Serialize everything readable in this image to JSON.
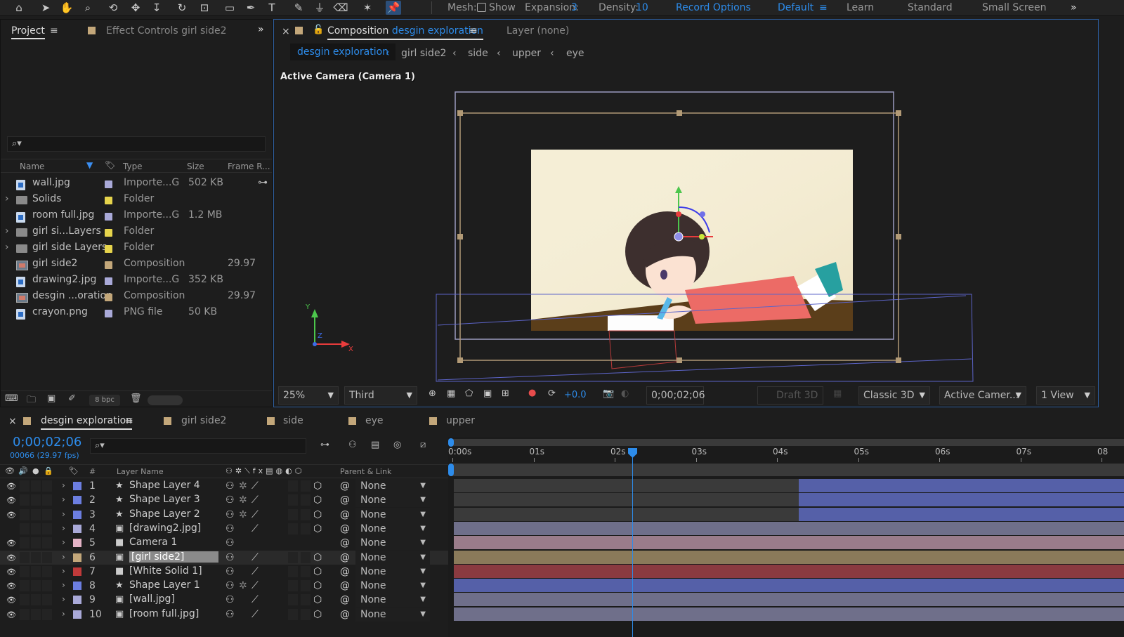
{
  "toolbar": {
    "mesh_label": "Mesh:",
    "show_label": "Show",
    "expansion_label": "Expansion:",
    "expansion_value": "3",
    "density_label": "Density:",
    "density_value": "10",
    "record_options": "Record Options",
    "workspaces": [
      "Default",
      "Learn",
      "Standard",
      "Small Screen"
    ],
    "overflow": "»"
  },
  "project_panel": {
    "tab_project": "Project",
    "tab_effect_controls": "Effect Controls girl side2",
    "overflow": "»",
    "columns": [
      "Name",
      "Type",
      "Size",
      "Frame R..."
    ],
    "items": [
      {
        "name": "wall.jpg",
        "type": "Importe...G",
        "size": "502 KB",
        "frame_rate": "",
        "kind": "file",
        "label_color": "#a9a9d8"
      },
      {
        "name": "Solids",
        "type": "Folder",
        "size": "",
        "frame_rate": "",
        "kind": "folder",
        "label_color": "#e6d44c"
      },
      {
        "name": "room full.jpg",
        "type": "Importe...G",
        "size": "1.2 MB",
        "frame_rate": "",
        "kind": "file",
        "label_color": "#a9a9d8"
      },
      {
        "name": "girl si...Layers",
        "type": "Folder",
        "size": "",
        "frame_rate": "",
        "kind": "folder",
        "label_color": "#e6d44c"
      },
      {
        "name": "girl side Layers",
        "type": "Folder",
        "size": "",
        "frame_rate": "",
        "kind": "folder",
        "label_color": "#e6d44c"
      },
      {
        "name": "girl side2",
        "type": "Composition",
        "size": "",
        "frame_rate": "29.97",
        "kind": "comp",
        "label_color": "#c3a77a"
      },
      {
        "name": "drawing2.jpg",
        "type": "Importe...G",
        "size": "352 KB",
        "frame_rate": "",
        "kind": "file",
        "label_color": "#a9a9d8"
      },
      {
        "name": "desgin ...oration",
        "type": "Composition",
        "size": "",
        "frame_rate": "29.97",
        "kind": "comp",
        "label_color": "#c3a77a"
      },
      {
        "name": "crayon.png",
        "type": "PNG file",
        "size": "50 KB",
        "frame_rate": "",
        "kind": "file",
        "label_color": "#a9a9d8"
      }
    ],
    "bpc": "8 bpc"
  },
  "composition_panel": {
    "close": "×",
    "tab_prefix": "Composition",
    "comp_name": "desgin exploration",
    "layer_tab": "Layer  (none)",
    "breadcrumbs": [
      "desgin exploration",
      "girl side2",
      "side",
      "upper",
      "eye"
    ],
    "camera_label": "Active Camera (Camera 1)",
    "axis_labels": {
      "x": "X",
      "y": "Y",
      "z": "Z"
    },
    "zoom": "25%",
    "resolution": "Third",
    "exposure": "+0.0",
    "timecode": "0;00;02;06",
    "draft3d": "Draft 3D",
    "renderer": "Classic 3D",
    "camera_view": "Active Camer...",
    "views": "1 View"
  },
  "timeline": {
    "tabs": [
      "desgin exploration",
      "girl side2",
      "side",
      "eye",
      "upper"
    ],
    "timecode": "0;00;02;06",
    "frame_info": "00066 (29.97 fps)",
    "col_number": "#",
    "col_layer_name": "Layer Name",
    "col_parent": "Parent & Link",
    "ruler": [
      "0:00s",
      "01s",
      "02s",
      "03s",
      "04s",
      "05s",
      "06s",
      "07s",
      "08"
    ],
    "layers": [
      {
        "num": "1",
        "name": "Shape Layer 4",
        "icon": "star-icon",
        "color": "#6c7ee0",
        "parent": "None",
        "bar_color": "#5560a8",
        "bar_start_pct": 51.5,
        "visible": true
      },
      {
        "num": "2",
        "name": "Shape Layer 3",
        "icon": "star-icon",
        "color": "#6c7ee0",
        "parent": "None",
        "bar_color": "#5560a8",
        "bar_start_pct": 51.5,
        "visible": true
      },
      {
        "num": "3",
        "name": "Shape Layer 2",
        "icon": "star-icon",
        "color": "#6c7ee0",
        "parent": "None",
        "bar_color": "#5560a8",
        "bar_start_pct": 51.5,
        "visible": true
      },
      {
        "num": "4",
        "name": "[drawing2.jpg]",
        "icon": "image-icon",
        "color": "#a9a9d8",
        "parent": "None",
        "bar_color": "#6f6f8a",
        "bar_start_pct": 0,
        "visible": false
      },
      {
        "num": "5",
        "name": "Camera 1",
        "icon": "camera-icon",
        "color": "#e4b3c6",
        "parent": "None",
        "bar_color": "#9a7c8a",
        "bar_start_pct": 0,
        "visible": true
      },
      {
        "num": "6",
        "name": "[girl side2]",
        "icon": "comp-icon",
        "color": "#c3a77a",
        "parent": "None",
        "bar_color": "#8a7a5a",
        "bar_start_pct": 0,
        "visible": true,
        "selected": true
      },
      {
        "num": "7",
        "name": "[White Solid 1]",
        "icon": "solid-icon",
        "color": "#c03a3a",
        "parent": "None",
        "bar_color": "#8a3a40",
        "bar_start_pct": 0,
        "visible": true
      },
      {
        "num": "8",
        "name": "Shape Layer 1",
        "icon": "star-icon",
        "color": "#6c7ee0",
        "parent": "None",
        "bar_color": "#5560a8",
        "bar_start_pct": 0,
        "visible": true
      },
      {
        "num": "9",
        "name": "[wall.jpg]",
        "icon": "image-icon",
        "color": "#a9a9d8",
        "parent": "None",
        "bar_color": "#6f6f8a",
        "bar_start_pct": 0,
        "visible": true
      },
      {
        "num": "10",
        "name": "[room full.jpg]",
        "icon": "image-icon",
        "color": "#a9a9d8",
        "parent": "None",
        "bar_color": "#6f6f8a",
        "bar_start_pct": 0,
        "visible": true
      }
    ]
  }
}
